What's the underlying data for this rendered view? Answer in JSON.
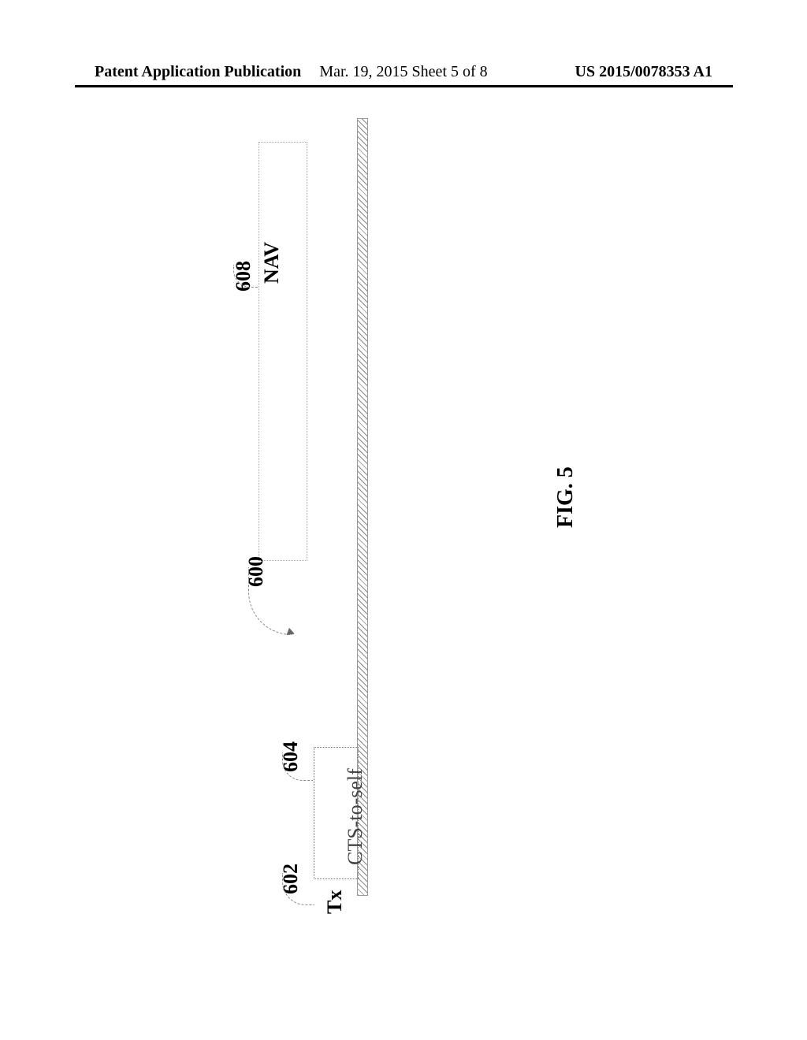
{
  "header": {
    "left": "Patent Application Publication",
    "center": "Mar. 19, 2015  Sheet 5 of 8",
    "right": "US 2015/0078353 A1"
  },
  "figure": {
    "caption": "FIG. 5",
    "tx_label": "Tx",
    "nav_label": "NAV",
    "cts_label": "CTS-to-self",
    "ref_600": "600",
    "ref_602": "602",
    "ref_604": "604",
    "ref_608": "608"
  }
}
